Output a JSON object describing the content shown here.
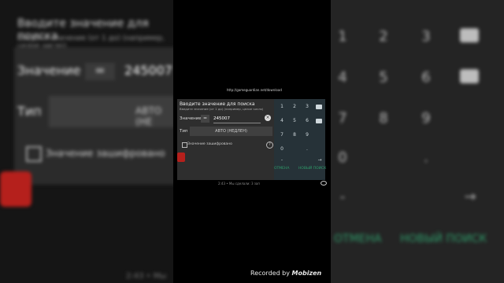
{
  "dialog": {
    "title": "Вводите значение для поиска",
    "subtitle": "Введите значение (от 1 до) (например, целое число)",
    "value_label": "Значение",
    "operator": "=",
    "value": "245007",
    "type_label": "Тип",
    "type_value": "АВТО (НЕДЛЕН)",
    "encrypted_label": "Значение зашифровано",
    "help": "?"
  },
  "keyboard": {
    "rows": [
      [
        "1",
        "2",
        "3",
        "⌫"
      ],
      [
        "4",
        "5",
        "6",
        "⌦"
      ],
      [
        "7",
        "8",
        "9",
        ""
      ],
      [
        "0",
        ".",
        ",",
        ""
      ],
      [
        "-",
        "",
        "",
        "→"
      ]
    ]
  },
  "actions": {
    "cancel": "ОТМЕНА",
    "search": "НОВЫЙ ПОИСК"
  },
  "url": "http://gameguardian.net/download",
  "caption": "2:43 • Мы сделали: 3 зап",
  "watermark": {
    "prefix": "Recorded by",
    "brand": "Mobizen"
  },
  "blur_left": {
    "title": "Вводите значение для поиска",
    "subtitle": "Введите значение (от 1 до) (например, целое число)",
    "value_label": "Значение",
    "operator": "=",
    "value": "245007",
    "type_label": "Тип",
    "type_value": "АВТО (НЕ",
    "encrypted_label": "Значение зашифровано",
    "bottom": "2:43 • Мы"
  },
  "blur_right": {
    "keys": [
      "1",
      "2",
      "3",
      "4",
      "5",
      "6",
      "7",
      "8",
      "9",
      "0",
      ".",
      "-",
      "→"
    ],
    "cancel": "ОТМЕНА",
    "search": "НОВЫЙ ПОИСК"
  }
}
